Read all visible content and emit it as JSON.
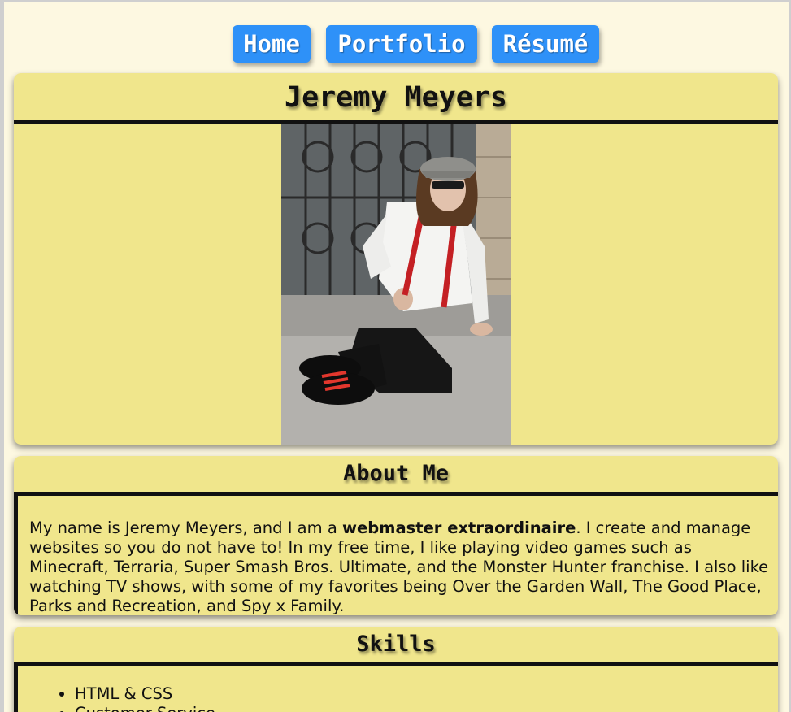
{
  "nav": {
    "items": [
      {
        "label": "Home"
      },
      {
        "label": "Portfolio"
      },
      {
        "label": "Résumé"
      }
    ]
  },
  "profile": {
    "name": "Jeremy Meyers"
  },
  "about": {
    "heading": "About Me",
    "text_before": "My name is Jeremy Meyers, and I am a ",
    "text_bold": "webmaster extraordinaire",
    "text_after": ". I create and manage websites so you do not have to! In my free time, I like playing video games such as Minecraft, Terraria, Super Smash Bros. Ultimate, and the Monster Hunter franchise. I also like watching TV shows, with some of my favorites being Over the Garden Wall, The Good Place, Parks and Recreation, and Spy x Family."
  },
  "skills": {
    "heading": "Skills",
    "items": [
      "HTML & CSS",
      "Customer Service"
    ]
  },
  "colors": {
    "page_background": "#fdf8e1",
    "card_background": "#f0e68c",
    "nav_button": "#2e91f8",
    "rule": "#111111"
  }
}
